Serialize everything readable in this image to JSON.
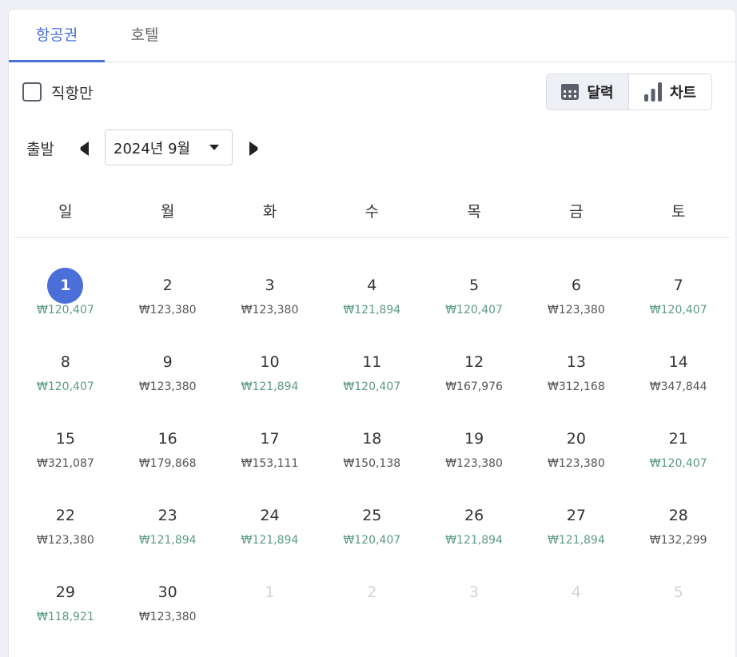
{
  "tabs": [
    {
      "label": "항공권",
      "active": true
    },
    {
      "label": "호텔",
      "active": false
    }
  ],
  "filter": {
    "direct_only_label": "직항만",
    "direct_only_checked": false
  },
  "view_toggle": {
    "calendar_label": "달력",
    "chart_label": "차트",
    "selected": "calendar"
  },
  "departure": {
    "label": "출발",
    "month_value": "2024년 9월"
  },
  "weekdays": [
    "일",
    "월",
    "화",
    "수",
    "목",
    "금",
    "토"
  ],
  "colors": {
    "accent": "#4a6fd9",
    "low_price": "#5c9a86",
    "normal_price": "#555555",
    "muted": "#cfd3da"
  },
  "weeks": [
    [
      {
        "day": "1",
        "price": "₩120,407",
        "low": true,
        "selected": true
      },
      {
        "day": "2",
        "price": "₩123,380",
        "low": false
      },
      {
        "day": "3",
        "price": "₩123,380",
        "low": false
      },
      {
        "day": "4",
        "price": "₩121,894",
        "low": true
      },
      {
        "day": "5",
        "price": "₩120,407",
        "low": true
      },
      {
        "day": "6",
        "price": "₩123,380",
        "low": false
      },
      {
        "day": "7",
        "price": "₩120,407",
        "low": true
      }
    ],
    [
      {
        "day": "8",
        "price": "₩120,407",
        "low": true
      },
      {
        "day": "9",
        "price": "₩123,380",
        "low": false
      },
      {
        "day": "10",
        "price": "₩121,894",
        "low": true
      },
      {
        "day": "11",
        "price": "₩120,407",
        "low": true
      },
      {
        "day": "12",
        "price": "₩167,976",
        "low": false
      },
      {
        "day": "13",
        "price": "₩312,168",
        "low": false
      },
      {
        "day": "14",
        "price": "₩347,844",
        "low": false
      }
    ],
    [
      {
        "day": "15",
        "price": "₩321,087",
        "low": false
      },
      {
        "day": "16",
        "price": "₩179,868",
        "low": false
      },
      {
        "day": "17",
        "price": "₩153,111",
        "low": false
      },
      {
        "day": "18",
        "price": "₩150,138",
        "low": false
      },
      {
        "day": "19",
        "price": "₩123,380",
        "low": false
      },
      {
        "day": "20",
        "price": "₩123,380",
        "low": false
      },
      {
        "day": "21",
        "price": "₩120,407",
        "low": true
      }
    ],
    [
      {
        "day": "22",
        "price": "₩123,380",
        "low": false
      },
      {
        "day": "23",
        "price": "₩121,894",
        "low": true
      },
      {
        "day": "24",
        "price": "₩121,894",
        "low": true
      },
      {
        "day": "25",
        "price": "₩120,407",
        "low": true
      },
      {
        "day": "26",
        "price": "₩121,894",
        "low": true
      },
      {
        "day": "27",
        "price": "₩121,894",
        "low": true
      },
      {
        "day": "28",
        "price": "₩132,299",
        "low": false
      }
    ],
    [
      {
        "day": "29",
        "price": "₩118,921",
        "low": true
      },
      {
        "day": "30",
        "price": "₩123,380",
        "low": false
      },
      {
        "day": "1",
        "price": "",
        "muted": true
      },
      {
        "day": "2",
        "price": "",
        "muted": true
      },
      {
        "day": "3",
        "price": "",
        "muted": true
      },
      {
        "day": "4",
        "price": "",
        "muted": true
      },
      {
        "day": "5",
        "price": "",
        "muted": true
      }
    ]
  ]
}
